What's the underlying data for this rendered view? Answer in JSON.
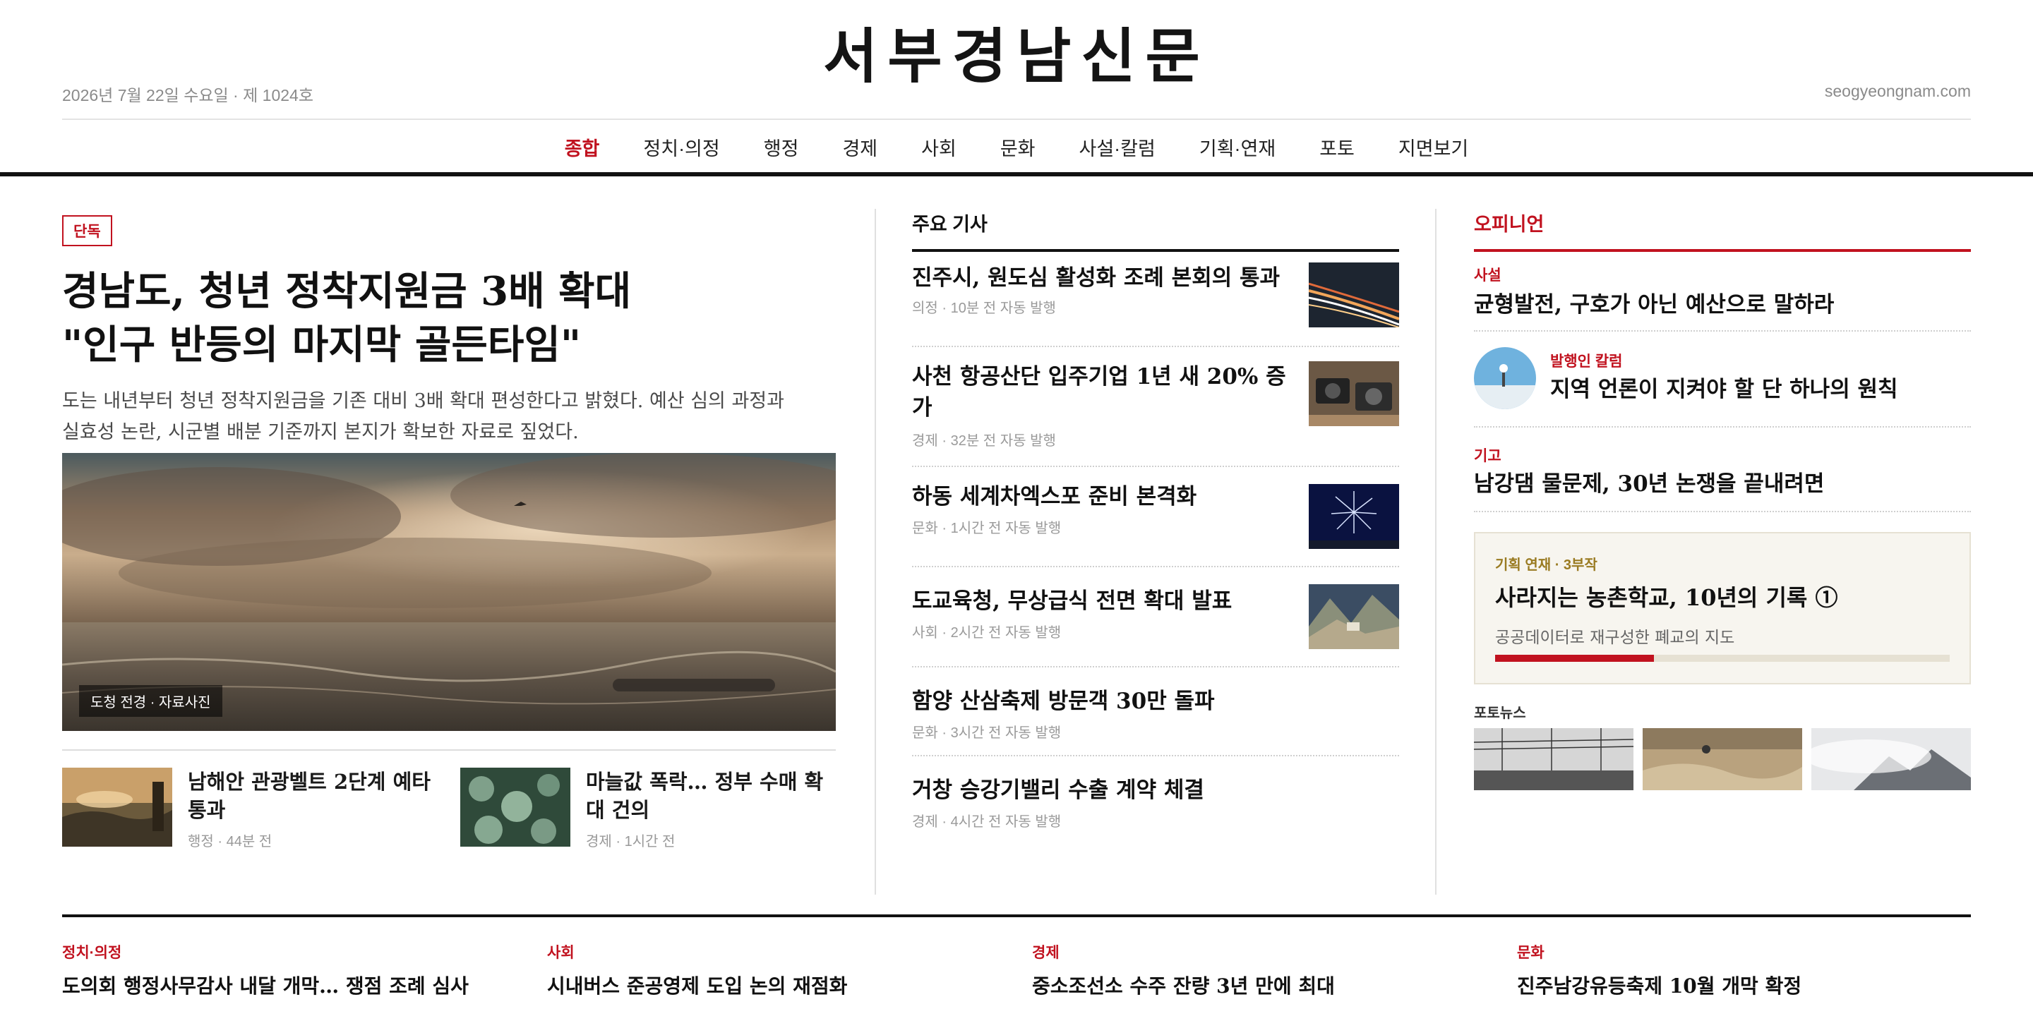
{
  "masthead": {
    "edition": "2026년 7월 22일 수요일 · 제 1024호",
    "logo": "서부경남신문",
    "url": "seogyeongnam.com"
  },
  "nav": [
    "종합",
    "정치·의정",
    "행정",
    "경제",
    "사회",
    "문화",
    "사설·칼럼",
    "기획·연재",
    "포토",
    "지면보기"
  ],
  "lead": {
    "badge": "단독",
    "title_line1": "경남도, 청년 정착지원금 3배 확대",
    "title_line2": "\"인구 반등의 마지막 골든타임\"",
    "summary_line1": "도는 내년부터 청년 정착지원금을 기존 대비 3배 확대 편성한다고 밝혔다. 예산 심의 과정과",
    "summary_line2": "실효성 논란, 시군별 배분 기준까지 본지가 확보한 자료로 짚었다.",
    "photo_caption": "도청 전경 · 자료사진",
    "sub_stories": [
      {
        "title": "남해안 관광벨트 2단계 예타 통과",
        "meta": "행정 · 44분 전"
      },
      {
        "title": "마늘값 폭락… 정부 수매 확대 건의",
        "meta": "경제 · 1시간 전"
      }
    ]
  },
  "top_stories": {
    "heading": "주요 기사",
    "items": [
      {
        "title": "진주시, 원도심 활성화 조례 본회의 통과",
        "meta": "의정 · 10분 전 자동 발행",
        "thumb": "light-trails"
      },
      {
        "title": "사천 항공산단 입주기업 1년 새 20% 증가",
        "meta": "경제 · 32분 전 자동 발행",
        "thumb": "cameras"
      },
      {
        "title": "하동 세계차엑스포 준비 본격화",
        "meta": "문화 · 1시간 전 자동 발행",
        "thumb": "fireworks"
      },
      {
        "title": "도교육청, 무상급식 전면 확대 발표",
        "meta": "사회 · 2시간 전 자동 발행",
        "thumb": "mountain-cabin"
      },
      {
        "title": "함양 산삼축제 방문객 30만 돌파",
        "meta": "문화 · 3시간 전 자동 발행"
      },
      {
        "title": "거창 승강기밸리 수출 계약 체결",
        "meta": "경제 · 4시간 전 자동 발행"
      }
    ]
  },
  "opinion": {
    "heading": "오피니언",
    "items": [
      {
        "kicker": "사설",
        "title": "균형발전, 구호가 아닌 예산으로 말하라"
      },
      {
        "kicker": "발행인 칼럼",
        "title": "지역 언론이 지켜야 할 단 하나의 원칙"
      },
      {
        "kicker": "기고",
        "title": "남강댐 물문제, 30년 논쟁을 끝내려면"
      }
    ]
  },
  "series": {
    "kicker": "기획 연재 · 3부작",
    "title": "사라지는 농촌학교, 10년의 기록 ①",
    "subtitle": "공공데이터로 재구성한 폐교의 지도",
    "progress": 0.35
  },
  "photo_news": {
    "heading": "포토뉴스"
  },
  "bottom": [
    {
      "kicker": "정치·의정",
      "title": "도의회 행정사무감사 내달 개막… 쟁점 조례 심사"
    },
    {
      "kicker": "사회",
      "title": "시내버스 준공영제 도입 논의 재점화"
    },
    {
      "kicker": "경제",
      "title": "중소조선소 수주 잔량 3년 만에 최대"
    },
    {
      "kicker": "문화",
      "title": "진주남강유등축제 10월 개막 확정"
    }
  ],
  "colors": {
    "accent": "#c1121f",
    "series_gold": "#9a7b22",
    "rule": "#111111"
  }
}
